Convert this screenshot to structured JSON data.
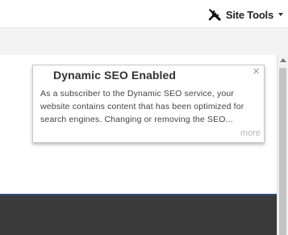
{
  "header": {
    "site_tools_label": "Site Tools",
    "site_tools_icon": "tools-icon",
    "dropdown_icon": "caret-down-icon"
  },
  "popup": {
    "title": "Dynamic SEO Enabled",
    "close_label": "×",
    "body": "As a subscriber to the Dynamic SEO service, your website contains content that has been optimized for search engines. Changing or removing the SEO...",
    "more_label": "more"
  },
  "colors": {
    "accent_line": "#2b4a78",
    "dark_band": "#3a3a3a",
    "subbar": "#f3f3f3"
  }
}
